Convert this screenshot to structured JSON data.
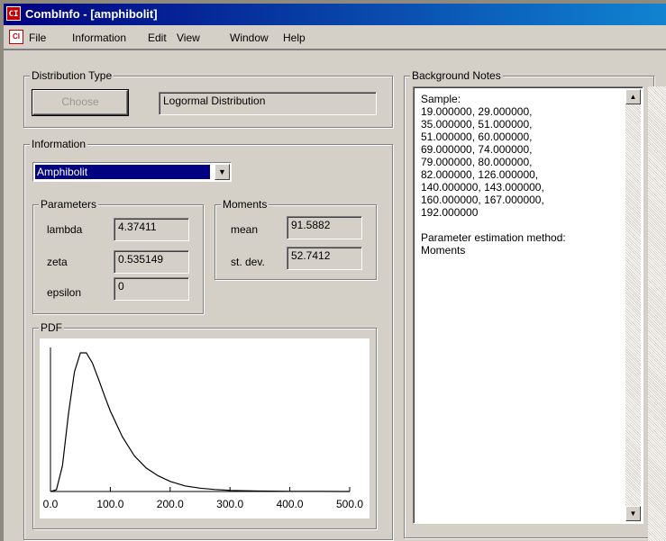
{
  "window": {
    "icon_text": "CI",
    "title": "CombInfo - [amphibolit]"
  },
  "menu": {
    "items": [
      "File",
      "Information",
      "Edit",
      "View",
      "Window",
      "Help"
    ]
  },
  "distribution_type": {
    "group_label": "Distribution Type",
    "choose_label": "Choose",
    "current_value": "Logormal Distribution"
  },
  "information": {
    "group_label": "Information",
    "selected_option": "Amphibolit",
    "parameters": {
      "group_label": "Parameters",
      "rows": [
        {
          "label": "lambda",
          "value": "4.37411"
        },
        {
          "label": "zeta",
          "value": "0.535149"
        },
        {
          "label": "epsilon",
          "value": "0"
        }
      ]
    },
    "moments": {
      "group_label": "Moments",
      "rows": [
        {
          "label": "mean",
          "value": "91.5882"
        },
        {
          "label": "st. dev.",
          "value": "52.7412"
        }
      ]
    }
  },
  "pdf": {
    "group_label": "PDF",
    "x_ticks": [
      "0.0",
      "100.0",
      "200.0",
      "300.0",
      "400.0",
      "500.0"
    ]
  },
  "chart_data": {
    "type": "line",
    "title": "PDF",
    "xlabel": "",
    "ylabel": "",
    "xlim": [
      0,
      500
    ],
    "x_ticks": [
      0,
      100,
      200,
      300,
      400,
      500
    ],
    "series": [
      {
        "x": [
          0,
          10,
          20,
          30,
          40,
          50,
          60,
          70,
          80,
          90,
          100,
          120,
          140,
          160,
          180,
          200,
          225,
          250,
          275,
          300,
          350,
          400,
          450,
          500
        ],
        "y": [
          0,
          0.00015,
          0.0023,
          0.0069,
          0.0107,
          0.0124,
          0.0124,
          0.0115,
          0.0101,
          0.0086,
          0.0072,
          0.0049,
          0.0032,
          0.0021,
          0.0014,
          0.0009,
          0.0005,
          0.0003,
          0.00018,
          0.0001,
          4e-05,
          1.5e-05,
          6e-06,
          2e-06
        ]
      }
    ]
  },
  "notes": {
    "group_label": "Background Notes",
    "text": "Sample:\n19.000000, 29.000000,\n35.000000, 51.000000,\n51.000000, 60.000000,\n69.000000, 74.000000,\n79.000000, 80.000000,\n82.000000, 126.000000,\n140.000000, 143.000000,\n160.000000, 167.000000,\n192.000000\n\nParameter estimation method:\nMoments"
  }
}
